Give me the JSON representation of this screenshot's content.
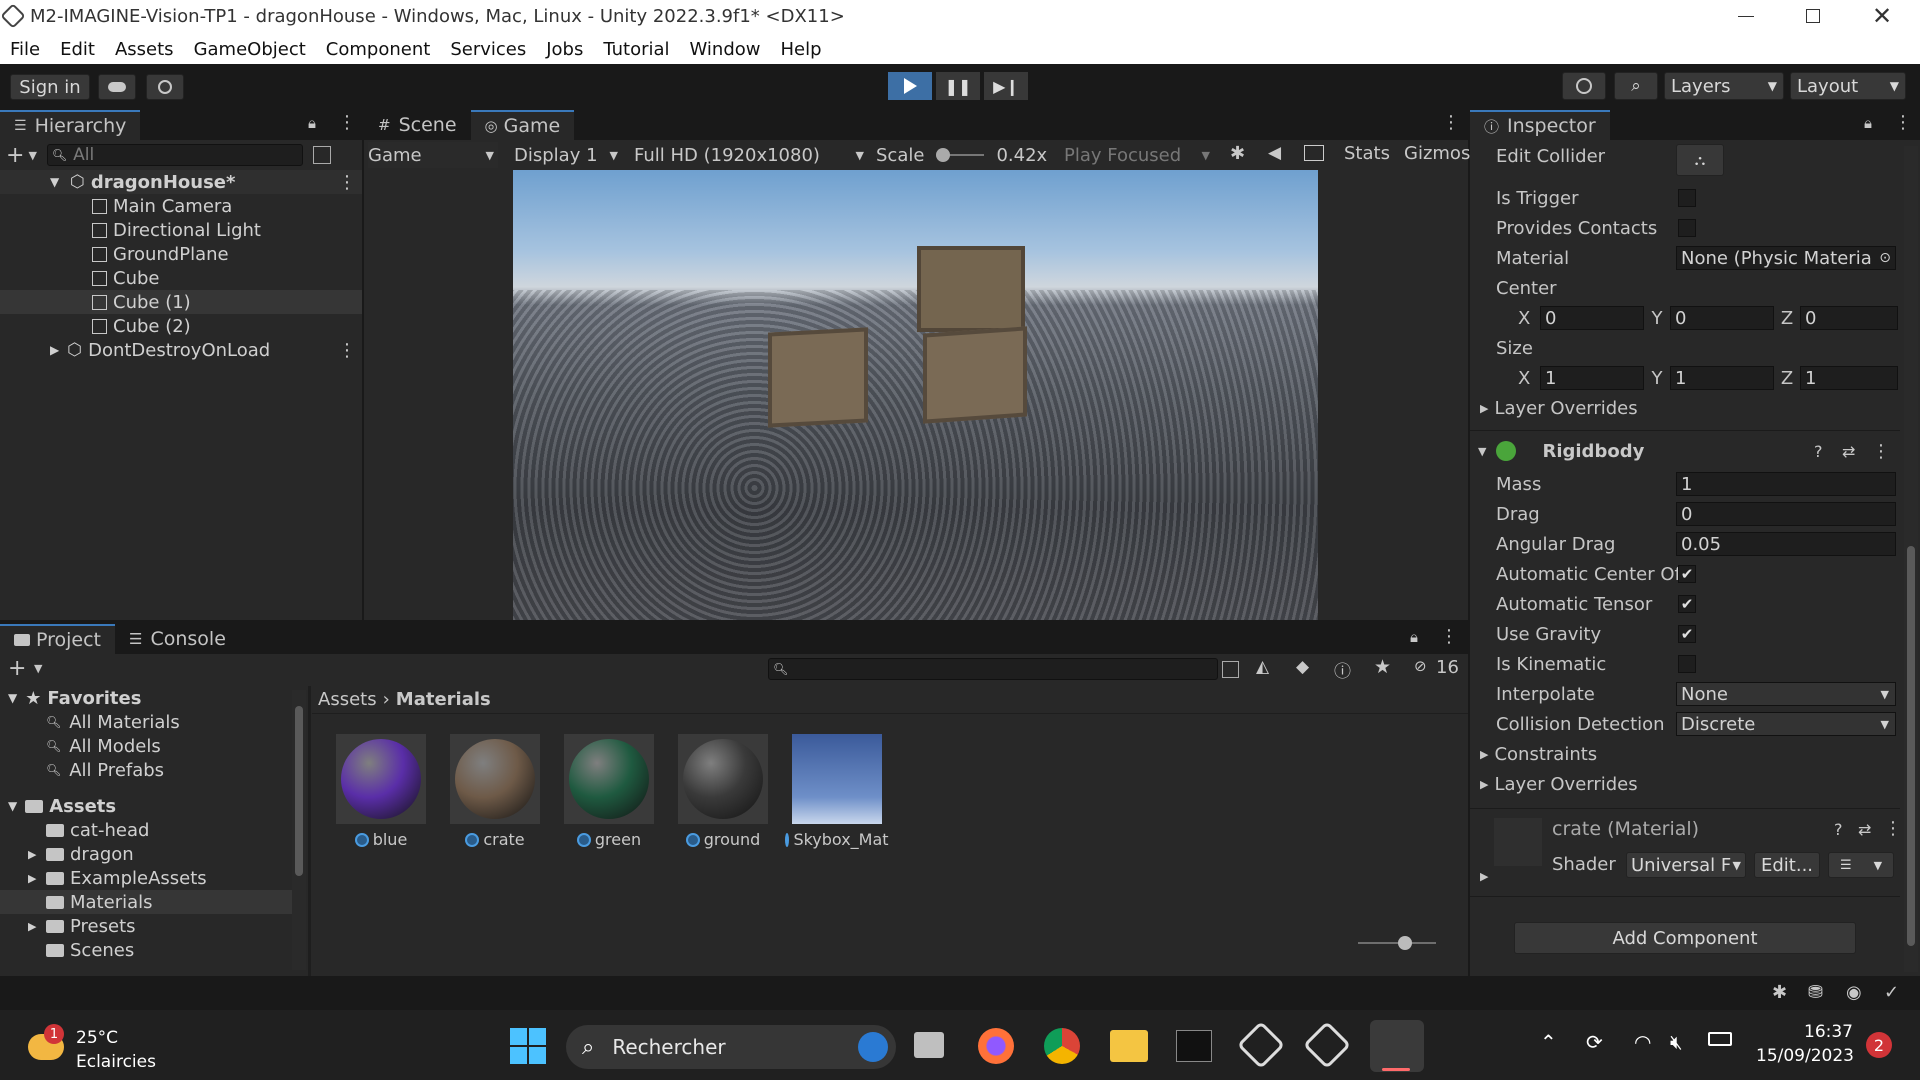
{
  "window": {
    "title": "M2-IMAGINE-Vision-TP1 - dragonHouse - Windows, Mac, Linux - Unity 2022.3.9f1* <DX11>"
  },
  "menu": [
    "File",
    "Edit",
    "Assets",
    "GameObject",
    "Component",
    "Services",
    "Jobs",
    "Tutorial",
    "Window",
    "Help"
  ],
  "toolbar": {
    "sign_in": "Sign in",
    "layers": "Layers",
    "layout": "Layout"
  },
  "hierarchy": {
    "tab": "Hierarchy",
    "search_placeholder": "All",
    "scene": "dragonHouse*",
    "items": [
      "Main Camera",
      "Directional Light",
      "GroundPlane",
      "Cube",
      "Cube (1)",
      "Cube (2)"
    ],
    "dont_destroy": "DontDestroyOnLoad"
  },
  "game": {
    "tabs": [
      "Scene",
      "Game"
    ],
    "view_mode": "Game",
    "display": "Display 1",
    "resolution": "Full HD (1920x1080)",
    "scale_label": "Scale",
    "scale_value": "0.42x",
    "play_focused": "Play Focused",
    "stats": "Stats",
    "gizmos": "Gizmos"
  },
  "project": {
    "tabs": [
      "Project",
      "Console"
    ],
    "hidden_count": "16",
    "favorites": "Favorites",
    "fav_items": [
      "All Materials",
      "All Models",
      "All Prefabs"
    ],
    "assets": "Assets",
    "asset_folders": [
      "cat-head",
      "dragon",
      "ExampleAssets",
      "Materials",
      "Presets",
      "Scenes"
    ],
    "breadcrumb": [
      "Assets",
      "Materials"
    ],
    "materials": [
      {
        "name": "blue",
        "color": "#5a2ea8"
      },
      {
        "name": "crate",
        "color": "#6e5a48"
      },
      {
        "name": "green",
        "color": "#1f5a40"
      },
      {
        "name": "ground",
        "color": "#3a3a3a"
      },
      {
        "name": "Skybox_Mat",
        "color": "#3b5a9a"
      }
    ]
  },
  "inspector": {
    "tab": "Inspector",
    "edit_collider": "Edit Collider",
    "is_trigger": "Is Trigger",
    "provides_contacts": "Provides Contacts",
    "material_label": "Material",
    "material_value": "None (Physic Materia",
    "center": "Center",
    "center_xyz": [
      "0",
      "0",
      "0"
    ],
    "size": "Size",
    "size_xyz": [
      "1",
      "1",
      "1"
    ],
    "layer_overrides": "Layer Overrides",
    "rigidbody": "Rigidbody",
    "mass_label": "Mass",
    "mass": "1",
    "drag_label": "Drag",
    "drag": "0",
    "angular_drag_label": "Angular Drag",
    "angular_drag": "0.05",
    "auto_center": "Automatic Center Of",
    "auto_tensor": "Automatic Tensor",
    "use_gravity": "Use Gravity",
    "is_kinematic": "Is Kinematic",
    "interpolate_label": "Interpolate",
    "interpolate": "None",
    "collision_label": "Collision Detection",
    "collision": "Discrete",
    "constraints": "Constraints",
    "layer_overrides2": "Layer Overrides",
    "material_comp": "crate (Material)",
    "shader_label": "Shader",
    "shader_value": "Universal F",
    "edit_btn": "Edit...",
    "add_component": "Add Component"
  },
  "taskbar": {
    "temperature": "25°C",
    "weather": "Eclaircies",
    "weather_badge": "1",
    "search": "Rechercher",
    "time": "16:37",
    "date": "15/09/2023",
    "notifications": "2"
  }
}
